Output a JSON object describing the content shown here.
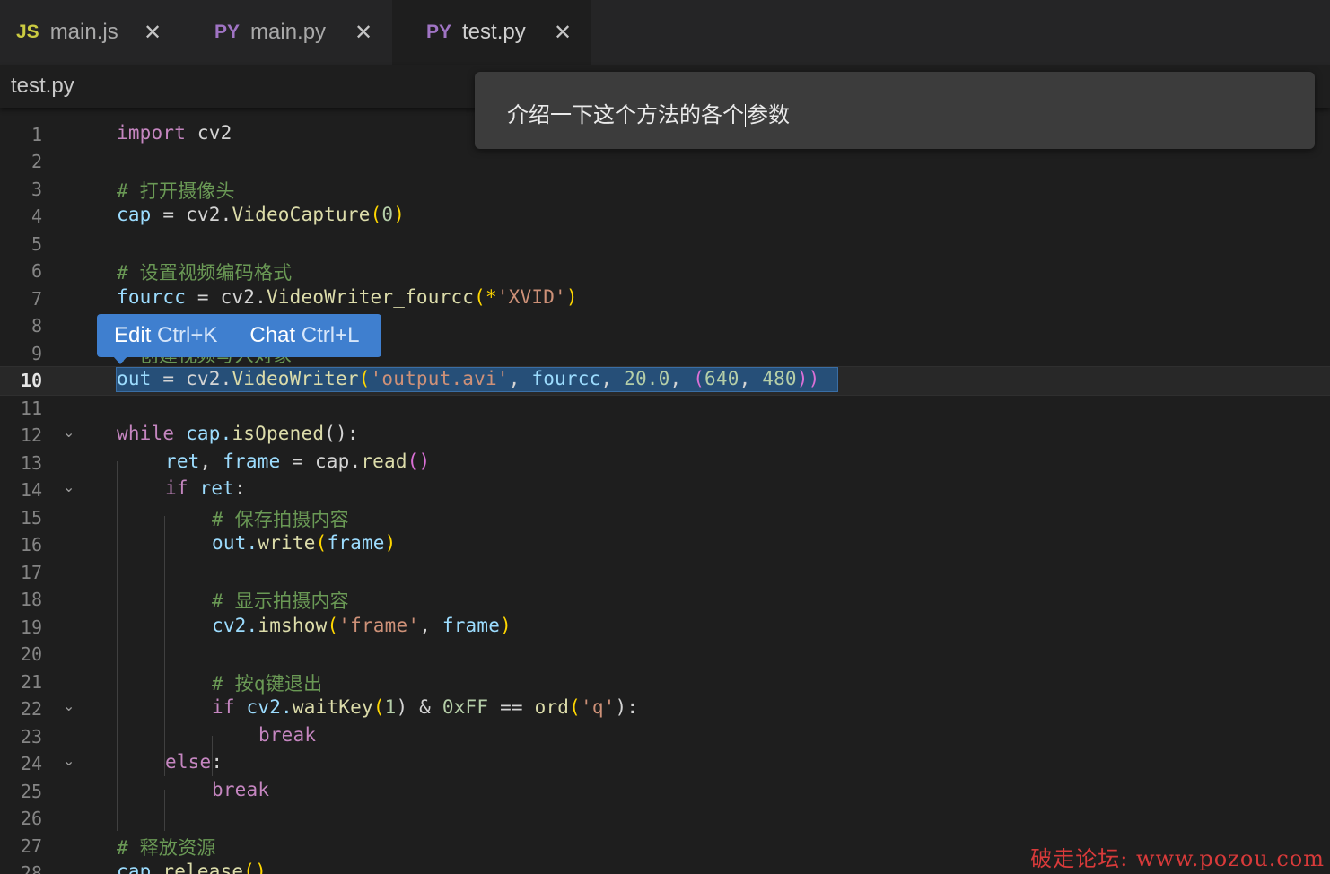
{
  "tabs": [
    {
      "badge": "JS",
      "label": "main.js",
      "close": "✕"
    },
    {
      "badge": "PY",
      "label": "main.py",
      "close": "✕"
    },
    {
      "badge": "PY",
      "label": "test.py",
      "close": "✕"
    }
  ],
  "breadcrumb": "test.py",
  "chat_input": {
    "before_caret": "介绍一下这个方法的各个",
    "after_caret": "参数"
  },
  "popup": {
    "edit_label": "Edit",
    "edit_shortcut": "Ctrl+K",
    "chat_label": "Chat",
    "chat_shortcut": "Ctrl+L"
  },
  "editor": {
    "current_line": 10,
    "lines": [
      {
        "n": "1"
      },
      {
        "n": "2"
      },
      {
        "n": "3"
      },
      {
        "n": "4"
      },
      {
        "n": "5"
      },
      {
        "n": "6"
      },
      {
        "n": "7"
      },
      {
        "n": "8"
      },
      {
        "n": "9"
      },
      {
        "n": "10"
      },
      {
        "n": "11"
      },
      {
        "n": "12"
      },
      {
        "n": "13"
      },
      {
        "n": "14"
      },
      {
        "n": "15"
      },
      {
        "n": "16"
      },
      {
        "n": "17"
      },
      {
        "n": "18"
      },
      {
        "n": "19"
      },
      {
        "n": "20"
      },
      {
        "n": "21"
      },
      {
        "n": "22"
      },
      {
        "n": "23"
      },
      {
        "n": "24"
      },
      {
        "n": "25"
      },
      {
        "n": "26"
      },
      {
        "n": "27"
      },
      {
        "n": "28"
      }
    ],
    "code": {
      "l1_kw": "import",
      "l1_rest": " cv2",
      "l3": "# 打开摄像头",
      "l4_a": "cap",
      "l4_b": " = cv2.",
      "l4_c": "VideoCapture",
      "l4_d": "(",
      "l4_e": "0",
      "l4_f": ")",
      "l6": "# 设置视频编码格式",
      "l7_a": "fourcc",
      "l7_b": " = cv2.",
      "l7_c": "VideoWriter_fourcc",
      "l7_d": "(*",
      "l7_e": "'XVID'",
      "l7_f": ")",
      "l9": "# 创建视频写入对象",
      "l10_a": "out",
      "l10_b": " = cv2.",
      "l10_c": "VideoWriter",
      "l10_d": "(",
      "l10_e": "'output.avi'",
      "l10_f": ", ",
      "l10_g": "fourcc",
      "l10_h": ", ",
      "l10_i": "20.0",
      "l10_j": ", ",
      "l10_k": "(",
      "l10_l": "640",
      "l10_m": ", ",
      "l10_n": "480",
      "l10_o": "))",
      "l12_a": "while",
      "l12_b": " cap.",
      "l12_c": "isOpened",
      "l12_d": "():",
      "l13_a": "ret",
      "l13_b": ", ",
      "l13_c": "frame",
      "l13_d": " = cap.",
      "l13_e": "read",
      "l13_f": "()",
      "l14_a": "if",
      "l14_b": " ret",
      "l14_c": ":",
      "l15": "# 保存拍摄内容",
      "l16_a": "out.",
      "l16_b": "write",
      "l16_c": "(",
      "l16_d": "frame",
      "l16_e": ")",
      "l18": "# 显示拍摄内容",
      "l19_a": "cv2.",
      "l19_b": "imshow",
      "l19_c": "(",
      "l19_d": "'frame'",
      "l19_e": ", ",
      "l19_f": "frame",
      "l19_g": ")",
      "l21": "# 按q键退出",
      "l22_a": "if",
      "l22_b": " cv2.",
      "l22_c": "waitKey",
      "l22_d": "(",
      "l22_e": "1",
      "l22_f": ") & ",
      "l22_g": "0xFF",
      "l22_h": " == ",
      "l22_i": "ord",
      "l22_j": "(",
      "l22_k": "'q'",
      "l22_l": "):",
      "l23": "break",
      "l24_a": "else",
      "l24_b": ":",
      "l25": "break",
      "l27": "# 释放资源",
      "l28_a": "cap.",
      "l28_b": "release",
      "l28_c": "()"
    }
  },
  "watermark": "破走论坛: www.pozou.com",
  "colors": {
    "keyword": "#c586c0",
    "comment": "#6a9955",
    "function": "#dcdcaa",
    "string": "#ce9178",
    "number": "#b5cea8",
    "variable": "#9cdcfe",
    "selection": "#264f78",
    "popup": "#3f7fcf"
  }
}
